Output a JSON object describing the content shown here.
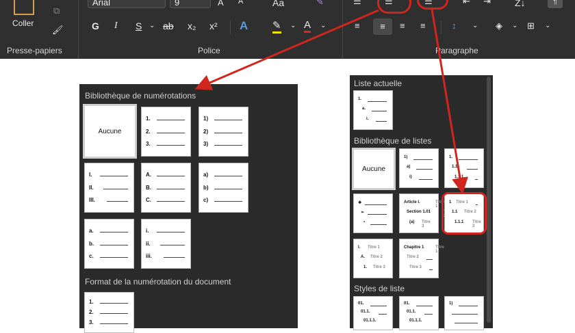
{
  "ribbon": {
    "clipboard": {
      "paste_label": "Coller",
      "group_label": "Presse-papiers"
    },
    "font": {
      "font_name": "Arial",
      "font_size": "9",
      "group_label": "Police",
      "bold": "G",
      "italic": "I",
      "underline": "S",
      "strike": "ab",
      "subscript": "x₂",
      "superscript": "x²",
      "change_case": "Aa"
    },
    "paragraph": {
      "group_label": "Paragraphe"
    },
    "sort_label": "Z↓"
  },
  "numbering_panel": {
    "library_title": "Bibliothèque de numérotations",
    "none_label": "Aucune",
    "tiles": [
      {
        "markers": [
          "1.",
          "2.",
          "3."
        ]
      },
      {
        "markers": [
          "1)",
          "2)",
          "3)"
        ]
      },
      {
        "markers": [
          "I.",
          "II.",
          "III."
        ]
      },
      {
        "markers": [
          "A.",
          "B.",
          "C."
        ]
      },
      {
        "markers": [
          "a)",
          "b)",
          "c)"
        ]
      },
      {
        "markers": [
          "a.",
          "b.",
          "c."
        ]
      },
      {
        "markers": [
          "i.",
          "ii.",
          "iii."
        ]
      }
    ],
    "document_format_title": "Format de la numérotation du document",
    "doc_tile": {
      "markers": [
        "1.",
        "2.",
        "3."
      ]
    }
  },
  "multilevel_panel": {
    "current_title": "Liste actuelle",
    "current_tile": {
      "markers": [
        "1.",
        "a.",
        "i."
      ]
    },
    "library_title": "Bibliothèque de listes",
    "none_label": "Aucune",
    "tiles": [
      {
        "markers": [
          "1)",
          "a)",
          "i)"
        ]
      },
      {
        "markers": [
          "1.",
          "1.1.",
          "1.1.1."
        ]
      },
      {
        "markers": [
          "❖",
          "➢",
          "▪"
        ]
      },
      {
        "markers": [
          "Article I.",
          "Section 1.01",
          "(a)"
        ],
        "suffixes": [
          "Titre 1",
          "Titre 2",
          "Titre 3"
        ]
      },
      {
        "markers": [
          "1",
          "1.1",
          "1.1.1"
        ],
        "suffixes": [
          "Titre 1",
          "Titre 2",
          "Titre 3"
        ]
      },
      {
        "markers": [
          "I.",
          "A.",
          "1."
        ],
        "suffixes": [
          "Titre 1",
          "Titre 2",
          "Titre 3"
        ]
      },
      {
        "markers": [
          "Chapitre 1",
          "",
          ""
        ],
        "suffixes": [
          "Titre 1",
          "Titre 2",
          "Titre 3"
        ]
      }
    ],
    "styles_title": "Styles de liste",
    "style_tiles": [
      {
        "markers": [
          "01.",
          "01.1.",
          "01.1.1."
        ]
      },
      {
        "markers": [
          "01.",
          "01.1.",
          "01.1.1."
        ]
      },
      {
        "markers": [
          "1)",
          "",
          ""
        ]
      }
    ]
  },
  "colors": {
    "ribbon": "#2f2f2f",
    "panel": "#2b2b2b",
    "highlight": "#d0261e"
  }
}
